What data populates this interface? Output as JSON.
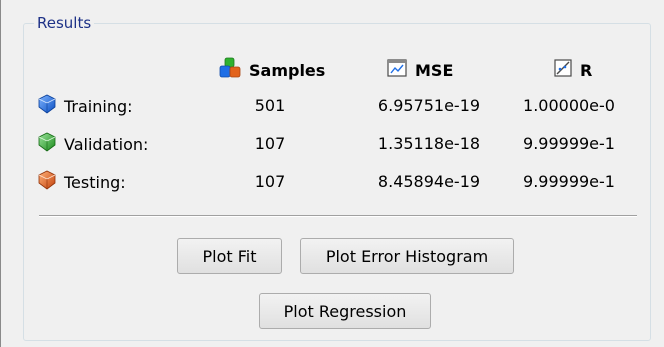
{
  "results": {
    "title": "Results",
    "headers": {
      "samples": "Samples",
      "mse": "MSE",
      "r": "R"
    },
    "rows": [
      {
        "label": "Training:",
        "icon": "blue-cube-icon",
        "color": "#1e6ee6",
        "samples": "501",
        "mse": "6.95751e-19",
        "r": "1.00000e-0"
      },
      {
        "label": "Validation:",
        "icon": "green-cube-icon",
        "color": "#2fb12f",
        "samples": "107",
        "mse": "1.35118e-18",
        "r": "9.99999e-1"
      },
      {
        "label": "Testing:",
        "icon": "red-cube-icon",
        "color": "#e2631c",
        "samples": "107",
        "mse": "8.45894e-19",
        "r": "9.99999e-1"
      }
    ]
  },
  "buttons": {
    "plot_fit": "Plot Fit",
    "plot_error_histogram": "Plot Error Histogram",
    "plot_regression": "Plot Regression"
  }
}
